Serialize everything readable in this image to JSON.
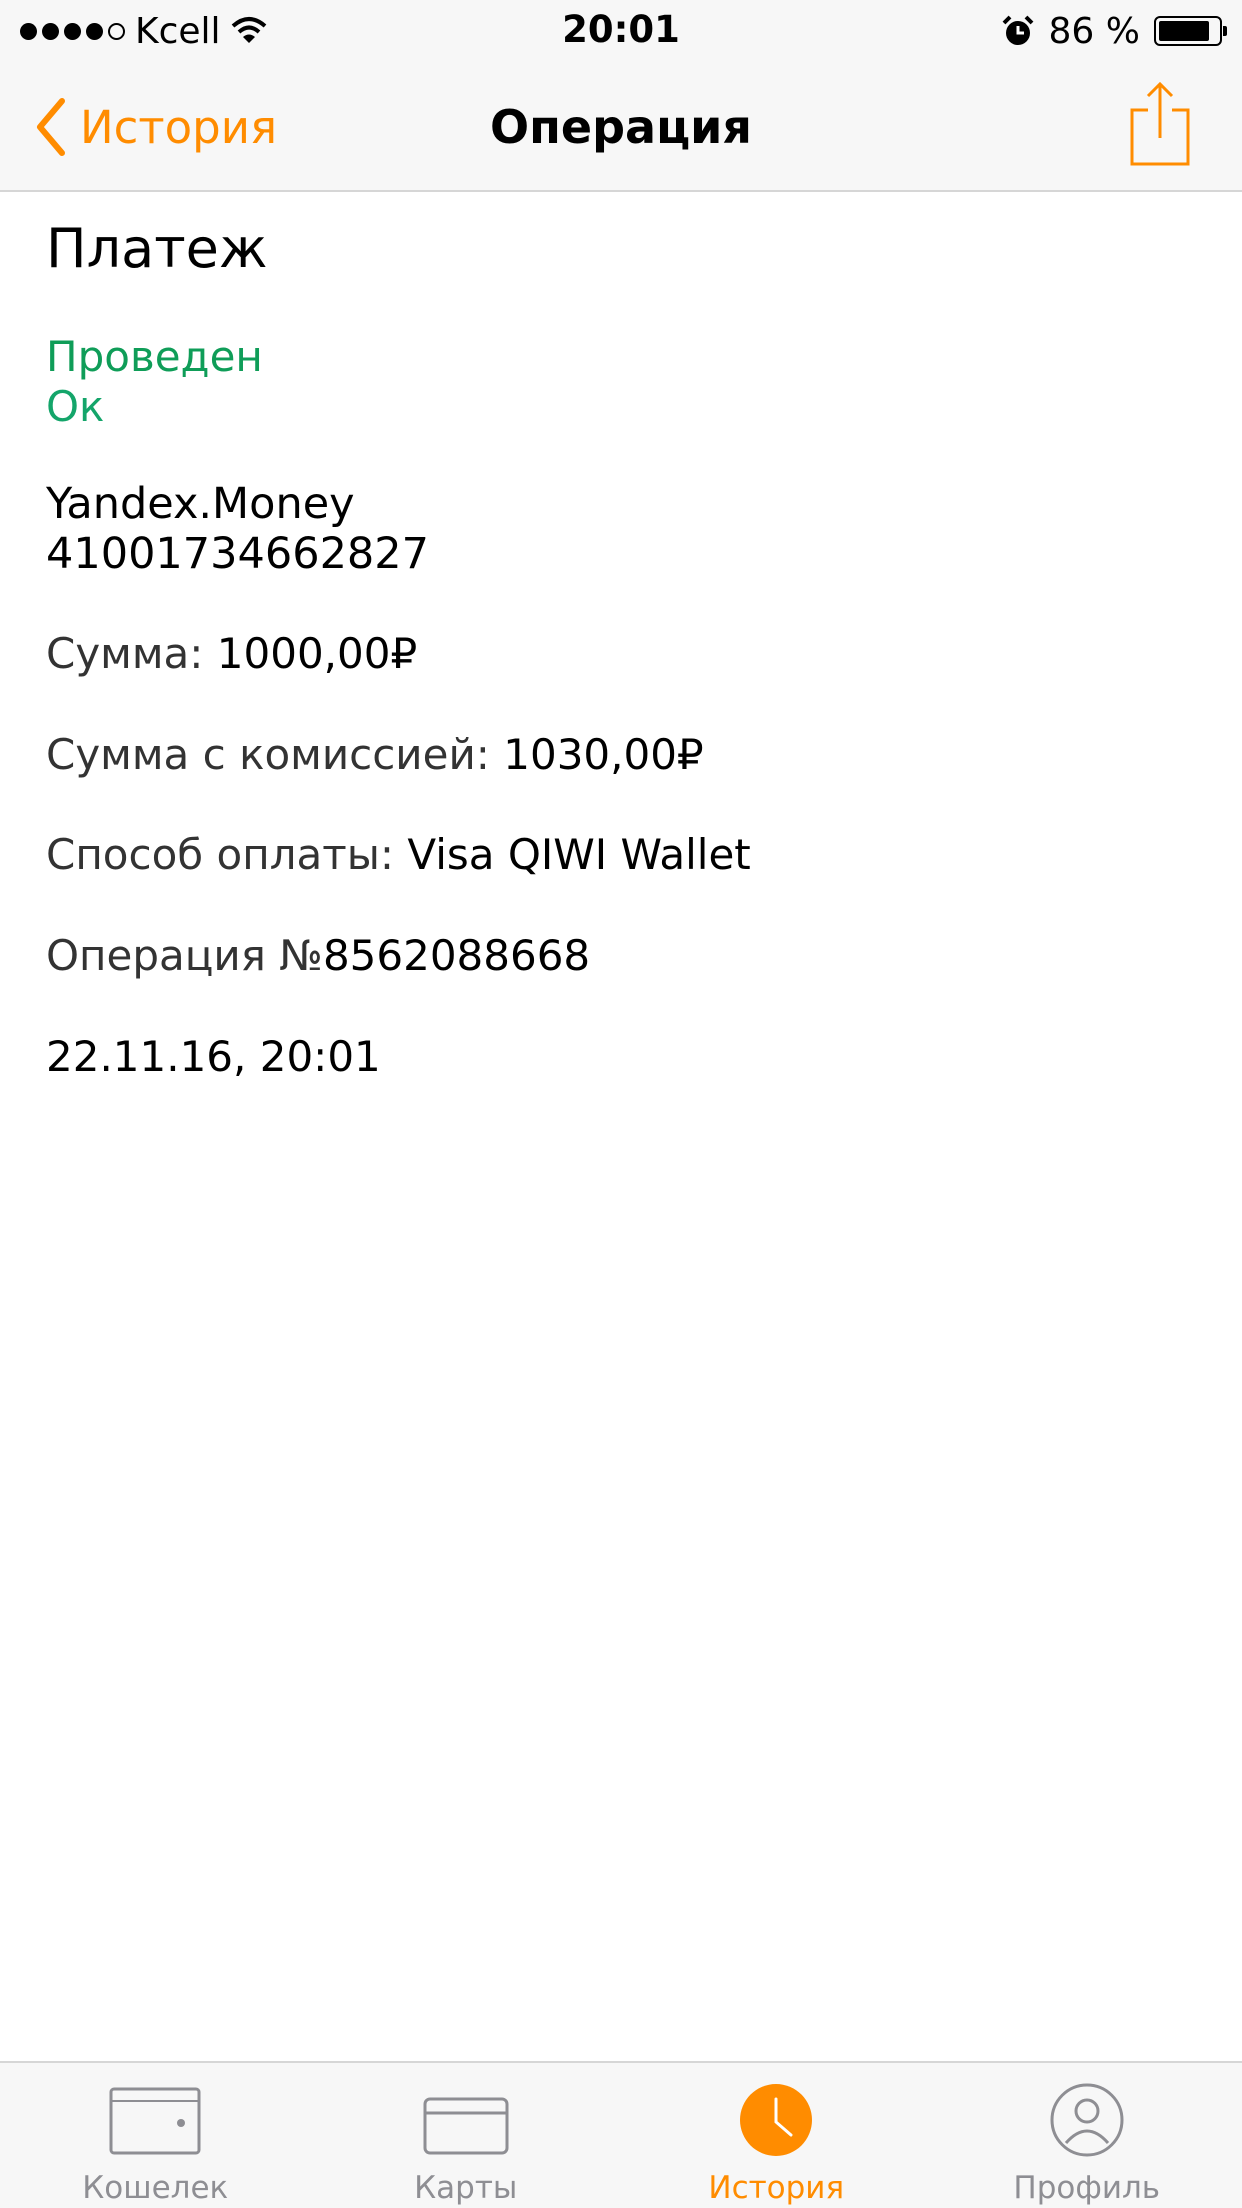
{
  "status_bar": {
    "carrier": "Kcell",
    "time": "20:01",
    "battery": "86 %",
    "battery_level": 0.86
  },
  "nav": {
    "back_label": "История",
    "title": "Операция"
  },
  "operation": {
    "type": "Платеж",
    "status": "Проведен",
    "status_detail": "Ок",
    "recipient_name": "Yandex.Money",
    "recipient_account": "41001734662827",
    "amount_label": "Сумма: ",
    "amount_value": "1000,00₽",
    "amount_fee_label": "Сумма с комиссией: ",
    "amount_fee_value": "1030,00₽",
    "method_label": "Способ оплаты: ",
    "method_value": "Visa QIWI Wallet",
    "op_number_label": "Операция №",
    "op_number_value": "8562088668",
    "datetime": "22.11.16, 20:01"
  },
  "tabs": [
    {
      "label": "Кошелек",
      "icon": "wallet-icon",
      "active": false
    },
    {
      "label": "Карты",
      "icon": "card-icon",
      "active": false
    },
    {
      "label": "История",
      "icon": "clock-icon",
      "active": true
    },
    {
      "label": "Профиль",
      "icon": "profile-icon",
      "active": false
    }
  ],
  "colors": {
    "accent": "#ff8c00",
    "success": "#0f9d58",
    "inactive": "#8e8e93"
  }
}
